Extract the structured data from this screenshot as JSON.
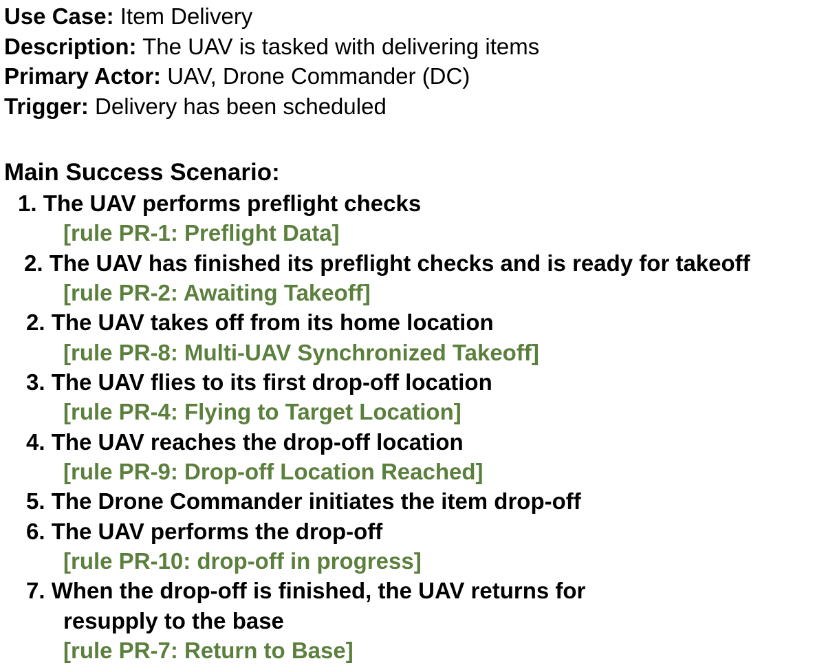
{
  "header": {
    "use_case_label": "Use Case:",
    "use_case_value": "Item Delivery",
    "description_label": "Description:",
    "description_value": "The UAV is tasked with delivering items",
    "primary_actor_label": "Primary Actor:",
    "primary_actor_value": "UAV, Drone Commander (DC)",
    "trigger_label": "Trigger:",
    "trigger_value": "Delivery has been scheduled"
  },
  "scenario": {
    "title": "Main Success Scenario:",
    "steps": [
      {
        "text": "1. The UAV performs preflight checks",
        "rule": "[rule PR-1: Preflight Data]"
      },
      {
        "text": "2. The UAV has finished its preflight checks and is ready for takeoff",
        "rule": "[rule PR-2: Awaiting Takeoff]"
      },
      {
        "text": "2. The UAV takes off from its home location",
        "rule": "[rule PR-8: Multi-UAV Synchronized Takeoff]"
      },
      {
        "text": "3. The UAV flies to its first drop-off location",
        "rule": "[rule PR-4: Flying to Target Location]"
      },
      {
        "text": "4. The UAV reaches the drop-off location",
        "rule": "[rule PR-9: Drop-off Location Reached]"
      },
      {
        "text": "5. The Drone Commander initiates the item drop-off"
      },
      {
        "text": "6. The UAV performs the drop-off",
        "rule": "[rule PR-10: drop-off in progress]"
      },
      {
        "text": "7. When the drop-off is finished, the UAV returns for",
        "continuation": "resupply to the base",
        "rule": "[rule PR-7: Return to Base]"
      }
    ]
  },
  "colors": {
    "text": "#000000",
    "rule": "#5b7f3c",
    "background": "#ffffff"
  }
}
